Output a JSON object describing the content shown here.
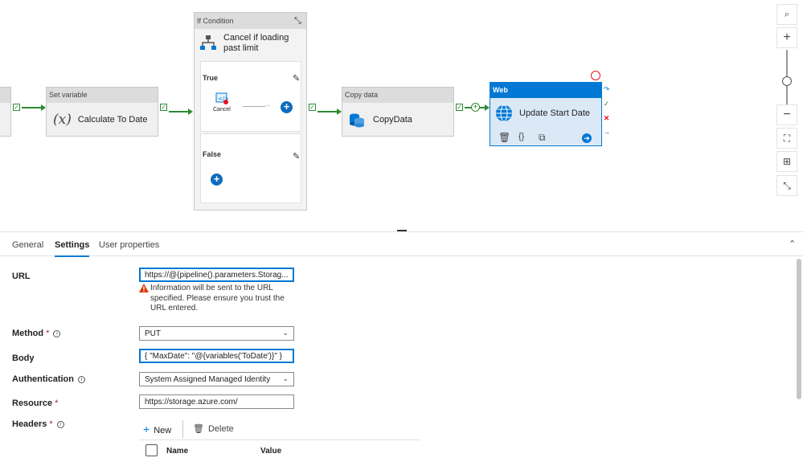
{
  "canvas": {
    "set_variable": {
      "type": "Set variable",
      "name": "Calculate To Date",
      "icon": "variable-icon"
    },
    "if_condition": {
      "type": "If Condition",
      "name": "Cancel if loading past limit",
      "true_label": "True",
      "false_label": "False",
      "true_activity": "Cancel"
    },
    "copy_data": {
      "type": "Copy data",
      "name": "CopyData"
    },
    "web": {
      "type": "Web",
      "name": "Update Start Date"
    }
  },
  "tabs": [
    {
      "label": "General"
    },
    {
      "label": "Settings"
    },
    {
      "label": "User properties"
    }
  ],
  "settings": {
    "url": {
      "label": "URL",
      "value": "https://@{pipeline().parameters.Storag...",
      "warning": "Information will be sent to the URL specified. Please ensure you trust the URL entered."
    },
    "method": {
      "label": "Method",
      "value": "PUT"
    },
    "body": {
      "label": "Body",
      "value": "{ \"MaxDate\": \"@{variables('ToDate')}\" }"
    },
    "authentication": {
      "label": "Authentication",
      "value": "System Assigned Managed Identity"
    },
    "resource": {
      "label": "Resource",
      "value": "https://storage.azure.com/"
    },
    "headers": {
      "label": "Headers",
      "new_label": "New",
      "delete_label": "Delete",
      "columns": [
        "Name",
        "Value"
      ]
    }
  },
  "colors": {
    "accent": "#0078d4",
    "success": "#2e8b32",
    "error": "#e81123"
  }
}
